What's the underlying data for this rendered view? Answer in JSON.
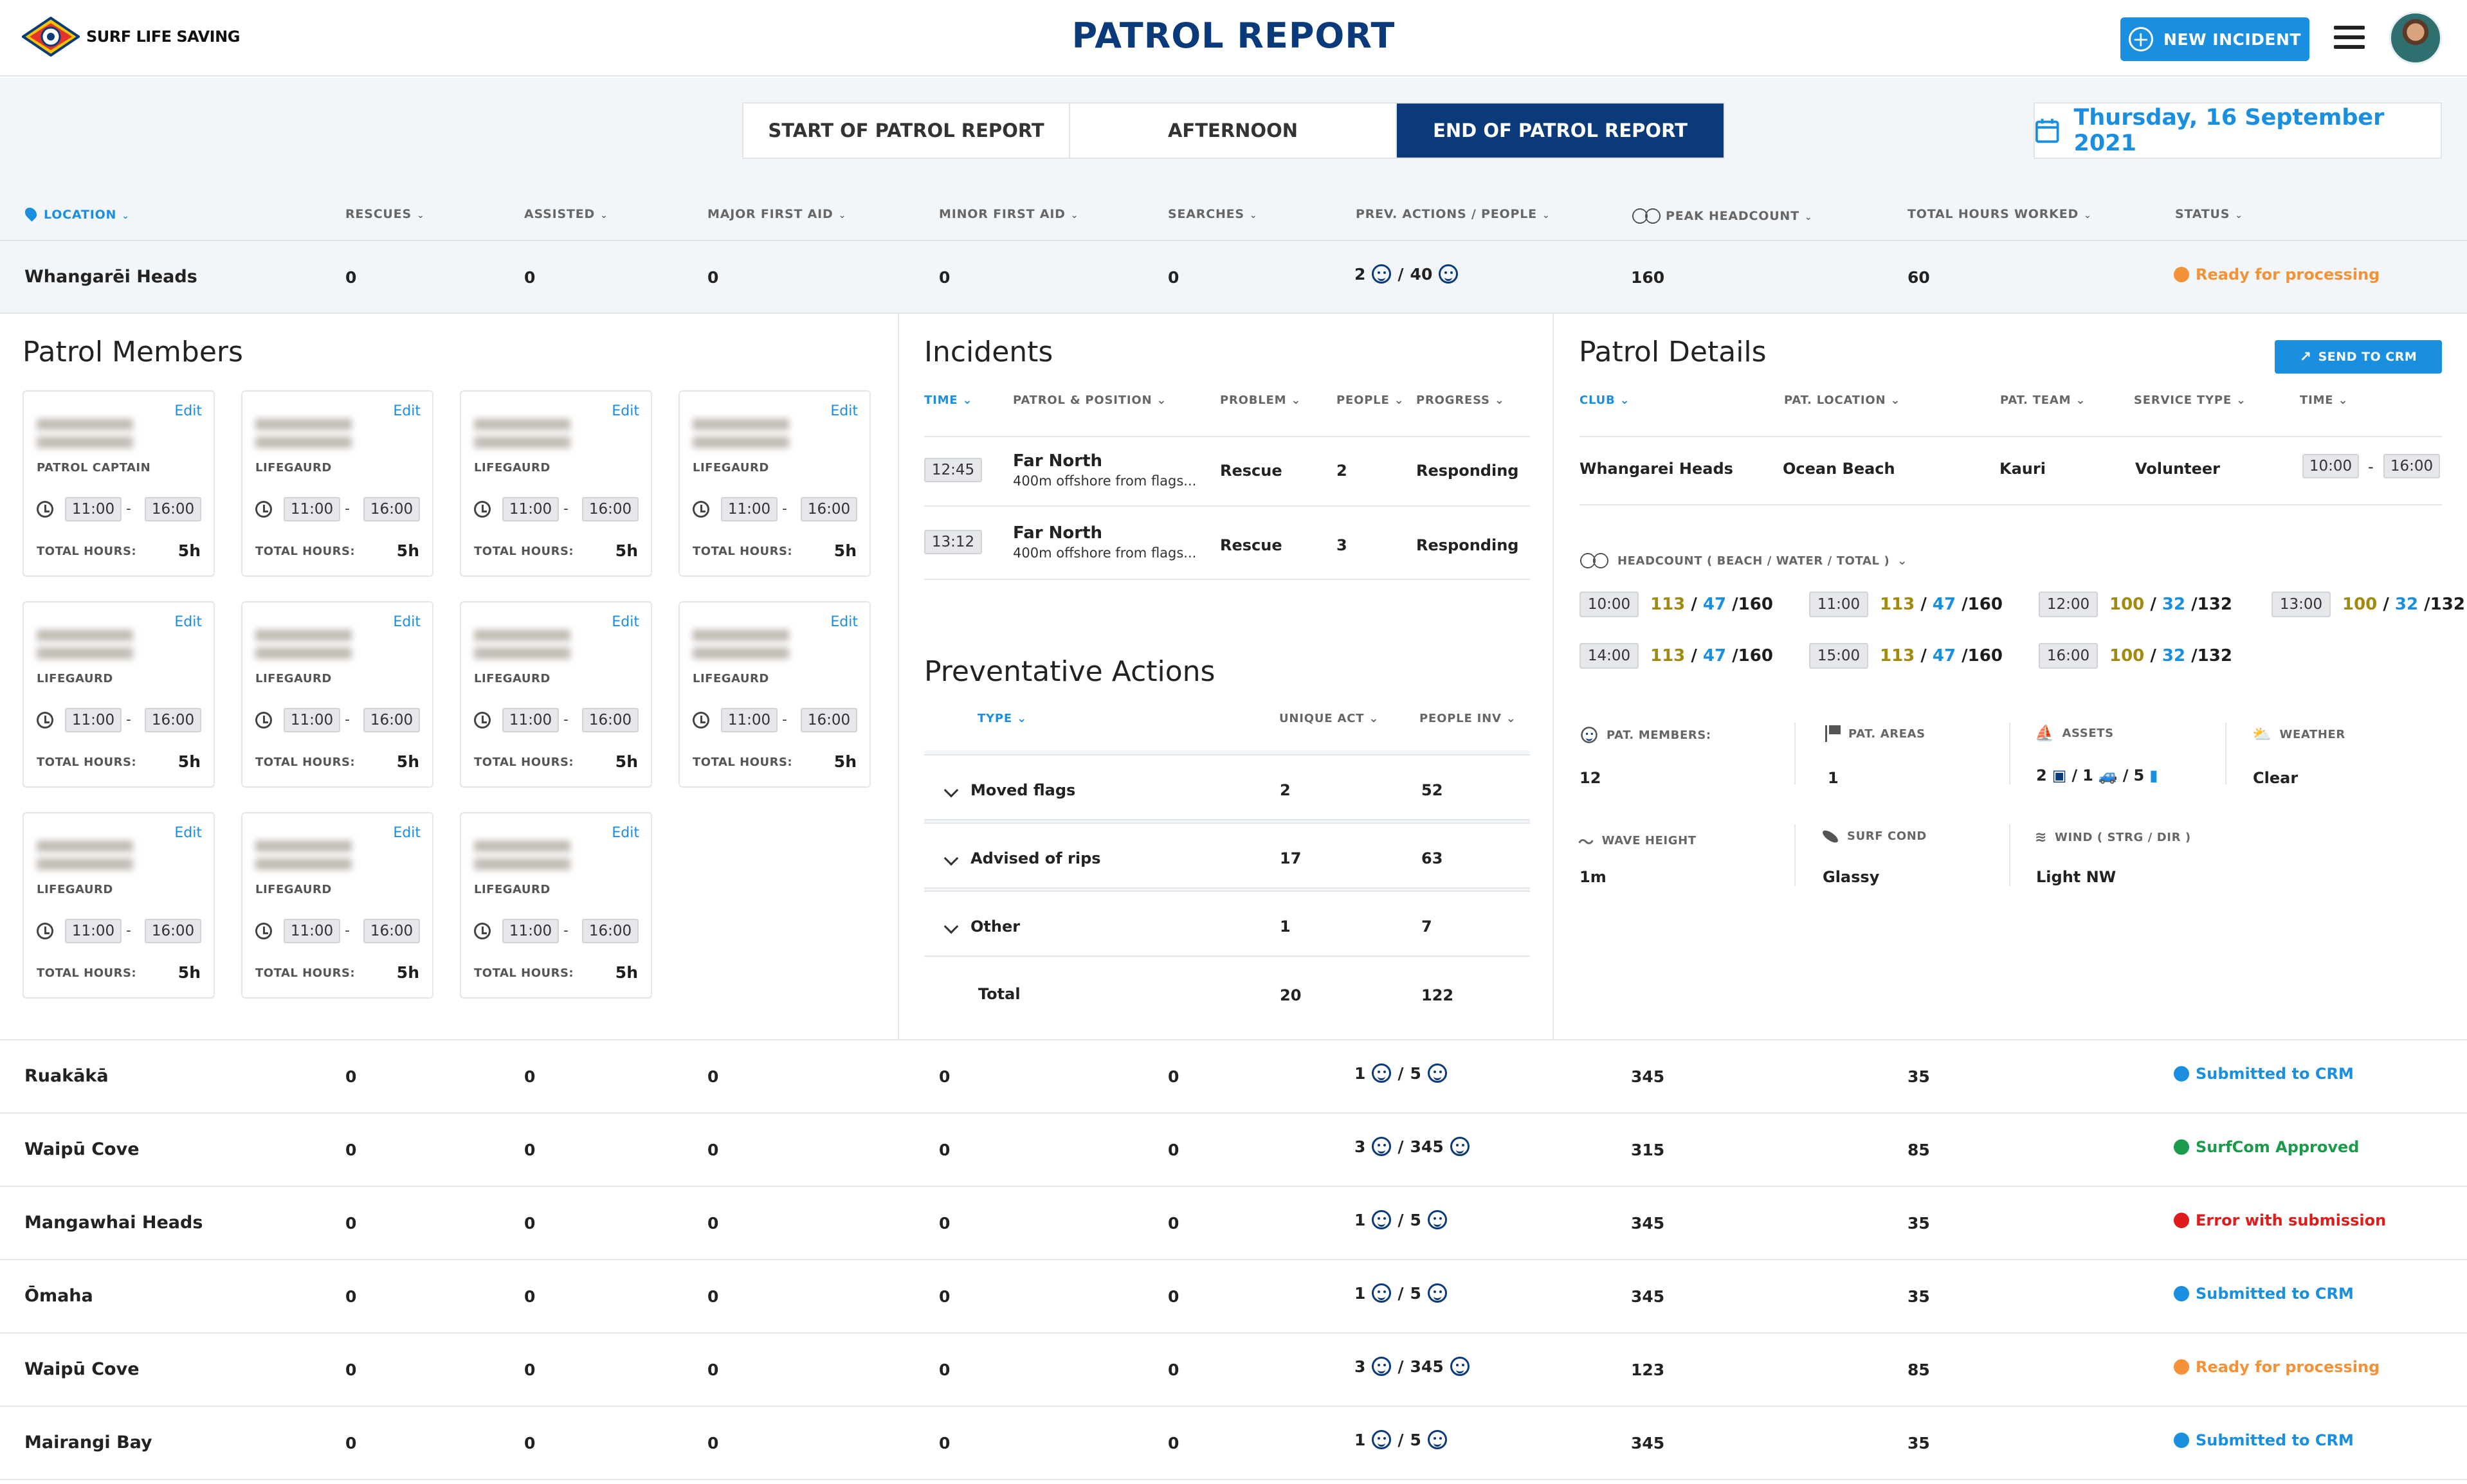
{
  "app": {
    "logo_text": "SURF LIFE SAVING",
    "title": "PATROL REPORT",
    "new_incident": "NEW INCIDENT"
  },
  "colors": {
    "brand_navy": "#0b3a7a",
    "accent_blue": "#1a8fe0",
    "status_orange": "#f39237",
    "status_blue": "#1a8fe0",
    "status_green": "#1a9a4a",
    "status_red": "#e01b1b"
  },
  "tabs": [
    {
      "label": "START OF PATROL REPORT",
      "active": false
    },
    {
      "label": "AFTERNOON",
      "active": false
    },
    {
      "label": "END OF PATROL REPORT",
      "active": true
    }
  ],
  "date": "Thursday, 16 September 2021",
  "columns": {
    "location": "LOCATION",
    "rescues": "RESCUES",
    "assisted": "ASSISTED",
    "major_first_aid": "MAJOR FIRST AID",
    "minor_first_aid": "MINOR FIRST AID",
    "searches": "SEARCHES",
    "prev_actions": "PREV. ACTIONS / PEOPLE",
    "peak_headcount": "PEAK HEADCOUNT",
    "total_hours": "TOTAL HOURS WORKED",
    "status": "STATUS"
  },
  "selected_row": {
    "location": "Whangarēi Heads",
    "rescues": "0",
    "assisted": "0",
    "major": "0",
    "minor": "0",
    "searches": "0",
    "prev_a": "2",
    "prev_sep": "/",
    "prev_b": "40",
    "peak": "160",
    "hours": "60",
    "status": "Ready for processing"
  },
  "patrol_members": {
    "title": "Patrol Members",
    "edit_label": "Edit",
    "total_label": "TOTAL HOURS:",
    "members": [
      {
        "role": "PATROL CAPTAIN",
        "start": "11:00",
        "end": "16:00",
        "hours": "5h"
      },
      {
        "role": "LIFEGAURD",
        "start": "11:00",
        "end": "16:00",
        "hours": "5h"
      },
      {
        "role": "LIFEGAURD",
        "start": "11:00",
        "end": "16:00",
        "hours": "5h"
      },
      {
        "role": "LIFEGAURD",
        "start": "11:00",
        "end": "16:00",
        "hours": "5h"
      },
      {
        "role": "LIFEGAURD",
        "start": "11:00",
        "end": "16:00",
        "hours": "5h"
      },
      {
        "role": "LIFEGAURD",
        "start": "11:00",
        "end": "16:00",
        "hours": "5h"
      },
      {
        "role": "LIFEGAURD",
        "start": "11:00",
        "end": "16:00",
        "hours": "5h"
      },
      {
        "role": "LIFEGAURD",
        "start": "11:00",
        "end": "16:00",
        "hours": "5h"
      },
      {
        "role": "LIFEGAURD",
        "start": "11:00",
        "end": "16:00",
        "hours": "5h"
      },
      {
        "role": "LIFEGAURD",
        "start": "11:00",
        "end": "16:00",
        "hours": "5h"
      },
      {
        "role": "LIFEGAURD",
        "start": "11:00",
        "end": "16:00",
        "hours": "5h"
      }
    ]
  },
  "incidents": {
    "title": "Incidents",
    "headers": {
      "time": "TIME",
      "patrol": "PATROL & POSITION",
      "problem": "PROBLEM",
      "people": "PEOPLE",
      "progress": "PROGRESS"
    },
    "rows": [
      {
        "time": "12:45",
        "patrol": "Far North",
        "position": "400m offshore from flags...",
        "problem": "Rescue",
        "people": "2",
        "progress": "Responding"
      },
      {
        "time": "13:12",
        "patrol": "Far North",
        "position": "400m offshore from flags...",
        "problem": "Rescue",
        "people": "3",
        "progress": "Responding"
      }
    ]
  },
  "preventative": {
    "title": "Preventative Actions",
    "headers": {
      "type": "TYPE",
      "unique": "UNIQUE ACT",
      "people": "PEOPLE INV"
    },
    "rows": [
      {
        "type": "Moved flags",
        "unique": "2",
        "people": "52"
      },
      {
        "type": "Advised of rips",
        "unique": "17",
        "people": "63"
      },
      {
        "type": "Other",
        "unique": "1",
        "people": "7"
      }
    ],
    "total": {
      "label": "Total",
      "unique": "20",
      "people": "122"
    }
  },
  "patrol_details": {
    "title": "Patrol Details",
    "send_label": "SEND TO CRM",
    "headers": {
      "club": "CLUB",
      "location": "PAT. LOCATION",
      "team": "PAT. TEAM",
      "service": "SERVICE TYPE",
      "time": "TIME"
    },
    "values": {
      "club": "Whangarei Heads",
      "location": "Ocean Beach",
      "team": "Kauri",
      "service": "Volunteer",
      "start": "10:00",
      "end": "16:00"
    },
    "headcount_label": "HEADCOUNT ( BEACH / WATER / TOTAL )",
    "headcounts": [
      {
        "time": "10:00",
        "beach": "113",
        "water": "47",
        "total": "160"
      },
      {
        "time": "11:00",
        "beach": "113",
        "water": "47",
        "total": "160"
      },
      {
        "time": "12:00",
        "beach": "100",
        "water": "32",
        "total": "132"
      },
      {
        "time": "13:00",
        "beach": "100",
        "water": "32",
        "total": "132"
      },
      {
        "time": "14:00",
        "beach": "113",
        "water": "47",
        "total": "160"
      },
      {
        "time": "15:00",
        "beach": "113",
        "water": "47",
        "total": "160"
      },
      {
        "time": "16:00",
        "beach": "100",
        "water": "32",
        "total": "132"
      }
    ],
    "stats": {
      "members_label": "PAT. MEMBERS:",
      "members": "12",
      "areas_label": "PAT. AREAS",
      "areas": "1",
      "assets_label": "ASSETS",
      "assets_a": "2",
      "assets_b": "1",
      "assets_c": "5",
      "weather_label": "WEATHER",
      "weather": "Clear",
      "wave_label": "WAVE HEIGHT",
      "wave": "1m",
      "surf_label": "SURF COND",
      "surf": "Glassy",
      "wind_label": "WIND ( STRG / DIR )",
      "wind": "Light NW"
    }
  },
  "rows": [
    {
      "location": "Ruakākā",
      "rescues": "0",
      "assisted": "0",
      "major": "0",
      "minor": "0",
      "searches": "0",
      "prev_a": "1",
      "prev_b": "5",
      "peak": "345",
      "hours": "35",
      "status": "Submitted to CRM",
      "status_color": "#1a8fe0"
    },
    {
      "location": "Waipū Cove",
      "rescues": "0",
      "assisted": "0",
      "major": "0",
      "minor": "0",
      "searches": "0",
      "prev_a": "3",
      "prev_b": "345",
      "peak": "315",
      "hours": "85",
      "status": "SurfCom Approved",
      "status_color": "#1a9a4a"
    },
    {
      "location": "Mangawhai Heads",
      "rescues": "0",
      "assisted": "0",
      "major": "0",
      "minor": "0",
      "searches": "0",
      "prev_a": "1",
      "prev_b": "5",
      "peak": "345",
      "hours": "35",
      "status": "Error with submission",
      "status_color": "#e01b1b"
    },
    {
      "location": "Ōmaha",
      "rescues": "0",
      "assisted": "0",
      "major": "0",
      "minor": "0",
      "searches": "0",
      "prev_a": "1",
      "prev_b": "5",
      "peak": "345",
      "hours": "35",
      "status": "Submitted to CRM",
      "status_color": "#1a8fe0"
    },
    {
      "location": "Waipū Cove",
      "rescues": "0",
      "assisted": "0",
      "major": "0",
      "minor": "0",
      "searches": "0",
      "prev_a": "3",
      "prev_b": "345",
      "peak": "123",
      "hours": "85",
      "status": "Ready for processing",
      "status_color": "#f39237"
    },
    {
      "location": "Mairangi Bay",
      "rescues": "0",
      "assisted": "0",
      "major": "0",
      "minor": "0",
      "searches": "0",
      "prev_a": "1",
      "prev_b": "5",
      "peak": "345",
      "hours": "35",
      "status": "Submitted to CRM",
      "status_color": "#1a8fe0"
    }
  ]
}
